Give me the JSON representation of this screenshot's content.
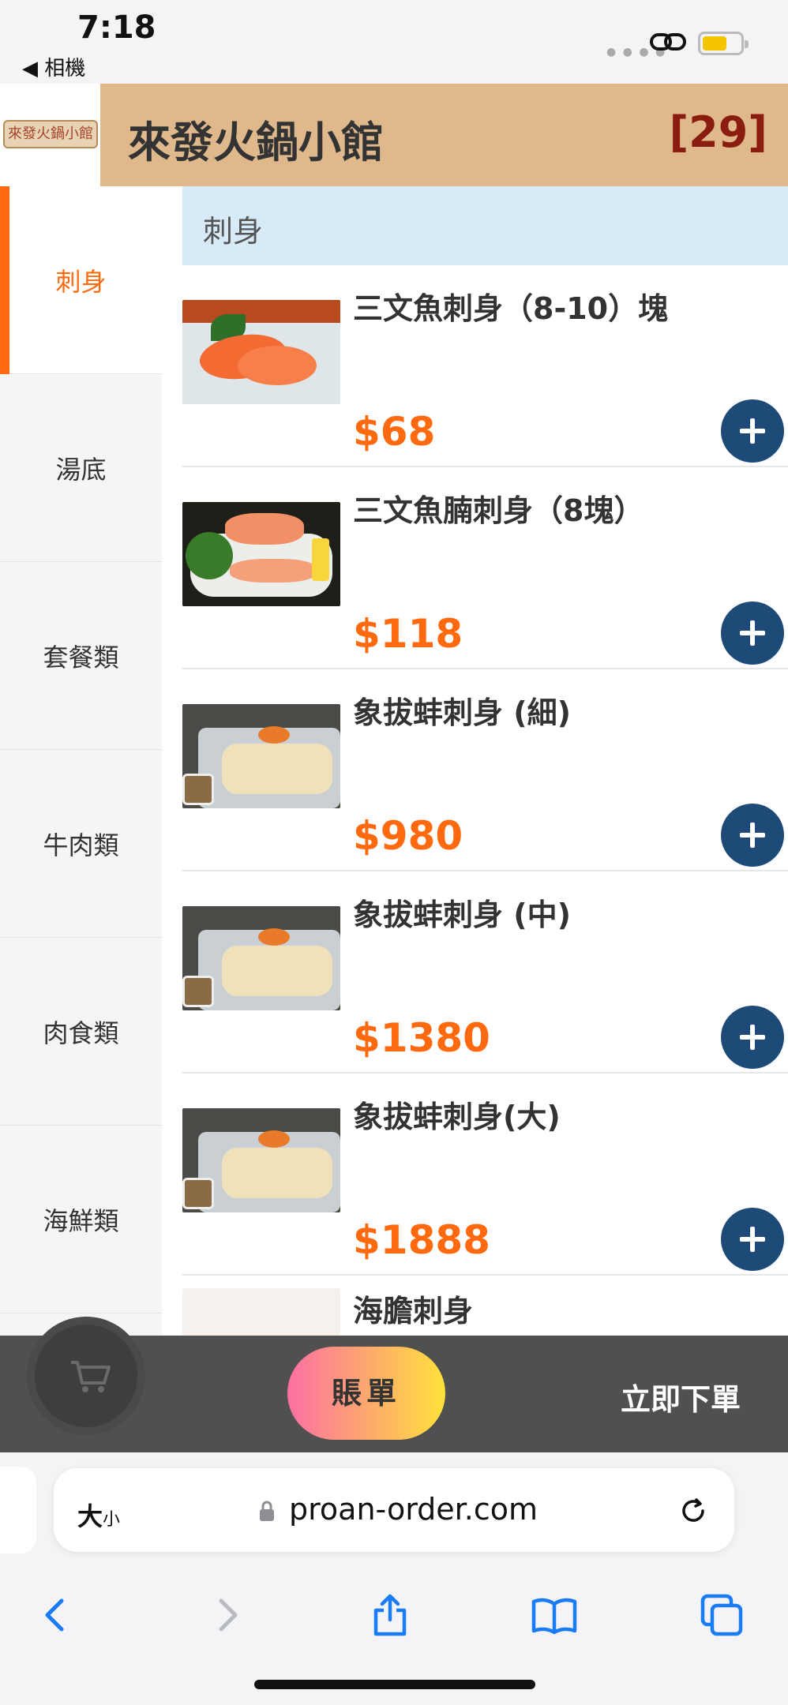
{
  "status_bar": {
    "time": "7:18",
    "back_label": "◀ 相機",
    "battery_color": "#f5c400"
  },
  "header": {
    "logo_text": "來發火鍋小館",
    "title": "來發火鍋小館",
    "count": "[29]"
  },
  "sidebar": {
    "categories": [
      {
        "label": "刺身",
        "active": true
      },
      {
        "label": "湯底"
      },
      {
        "label": "套餐類"
      },
      {
        "label": "牛肉類"
      },
      {
        "label": "肉食類"
      },
      {
        "label": "海鮮類"
      }
    ]
  },
  "main": {
    "section_title": "刺身",
    "items": [
      {
        "name": "三文魚刺身（8-10）塊",
        "price": "$68",
        "image": "salmon-sashimi"
      },
      {
        "name": "三文魚腩刺身（8塊）",
        "price": "$118",
        "image": "salmon-belly-sashimi"
      },
      {
        "name": "象拔蚌刺身 (細)",
        "price": "$980",
        "image": "geoduck-sashimi"
      },
      {
        "name": "象拔蚌刺身 (中)",
        "price": "$1380",
        "image": "geoduck-sashimi"
      },
      {
        "name": "象拔蚌刺身(大)",
        "price": "$1888",
        "image": "geoduck-sashimi"
      },
      {
        "name": "海膽刺身",
        "image": "sea-urchin-sashimi"
      }
    ]
  },
  "order_bar": {
    "cart_icon": "shopping-cart-icon",
    "bill_label": "賬單",
    "submit_label": "立即下單"
  },
  "browser": {
    "text_size_label": "大",
    "text_size_small": "小",
    "url": "proan-order.com",
    "icons": [
      "back-arrow-icon",
      "forward-arrow-icon",
      "share-icon",
      "bookmarks-icon",
      "tabs-icon",
      "reload-icon",
      "lock-icon"
    ]
  },
  "colors": {
    "header_bg": "#dfb88b",
    "accent_orange": "#ff6a10",
    "add_button": "#1e4a78",
    "section_bg": "#d7eaf8",
    "count_color": "#8a1c10"
  }
}
